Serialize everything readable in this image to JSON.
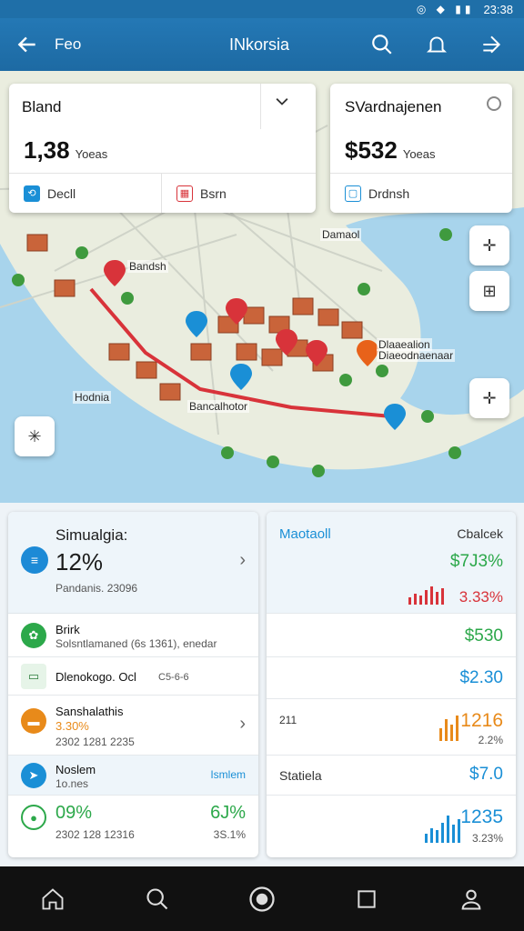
{
  "status": {
    "time": "23:38"
  },
  "appbar": {
    "back_label": "Feo",
    "title": "INkorsia"
  },
  "map": {
    "card_left": {
      "title": "Bland",
      "value": "1,38",
      "unit": "Yoeas",
      "btn1": "Decll",
      "btn2": "Bsrn"
    },
    "card_right": {
      "title": "SVardnajenen",
      "value": "$532",
      "unit": "Yoeas",
      "btn": "Drdnsh"
    },
    "labels": [
      "Bandsh",
      "Damaol",
      "Hodnia",
      "Bancalhotor",
      "Dlaaealion",
      "Diaeodnaenaar"
    ]
  },
  "left_panel": {
    "header": {
      "title": "Simualgia:",
      "value": "12%",
      "sub": "Pandanis. 23096"
    },
    "rows": [
      {
        "a": "Brirk",
        "b": "Solsntlamaned (6s 1361), enedar"
      },
      {
        "a": "Dlenokogo. Ocl",
        "b": "",
        "c": "C5-6-6"
      },
      {
        "a": "Sanshalathis",
        "b": "3.30%",
        "c": "2302 1281 2235"
      },
      {
        "a": "Noslem",
        "b": "1o.nes",
        "c": "Ismlem"
      },
      {
        "a": "09%",
        "b": "2302 128 12316",
        "c": "6J%",
        "d": "3S.1%"
      }
    ]
  },
  "right_panel": {
    "title": "Maotaoll",
    "subtitle": "Cbalcek",
    "rows": [
      {
        "label": "",
        "value": "$7J3%",
        "sub": "3.33%"
      },
      {
        "label": "",
        "value": "$530"
      },
      {
        "label": "",
        "value": "$2.30"
      },
      {
        "label": "211",
        "value": "1216",
        "sub": "2.2%"
      },
      {
        "label": "Statiela",
        "value": "$7.0"
      },
      {
        "label": "",
        "value": "1235",
        "sub": "3.23%"
      }
    ]
  },
  "colors": {
    "accent": "#1f6fa8",
    "green": "#2ca84a",
    "red": "#d8333a",
    "orange": "#e88a1a",
    "blue": "#1a8fd6"
  },
  "nav": [
    "home-icon",
    "search-icon",
    "record-icon",
    "square-icon",
    "profile-icon"
  ]
}
